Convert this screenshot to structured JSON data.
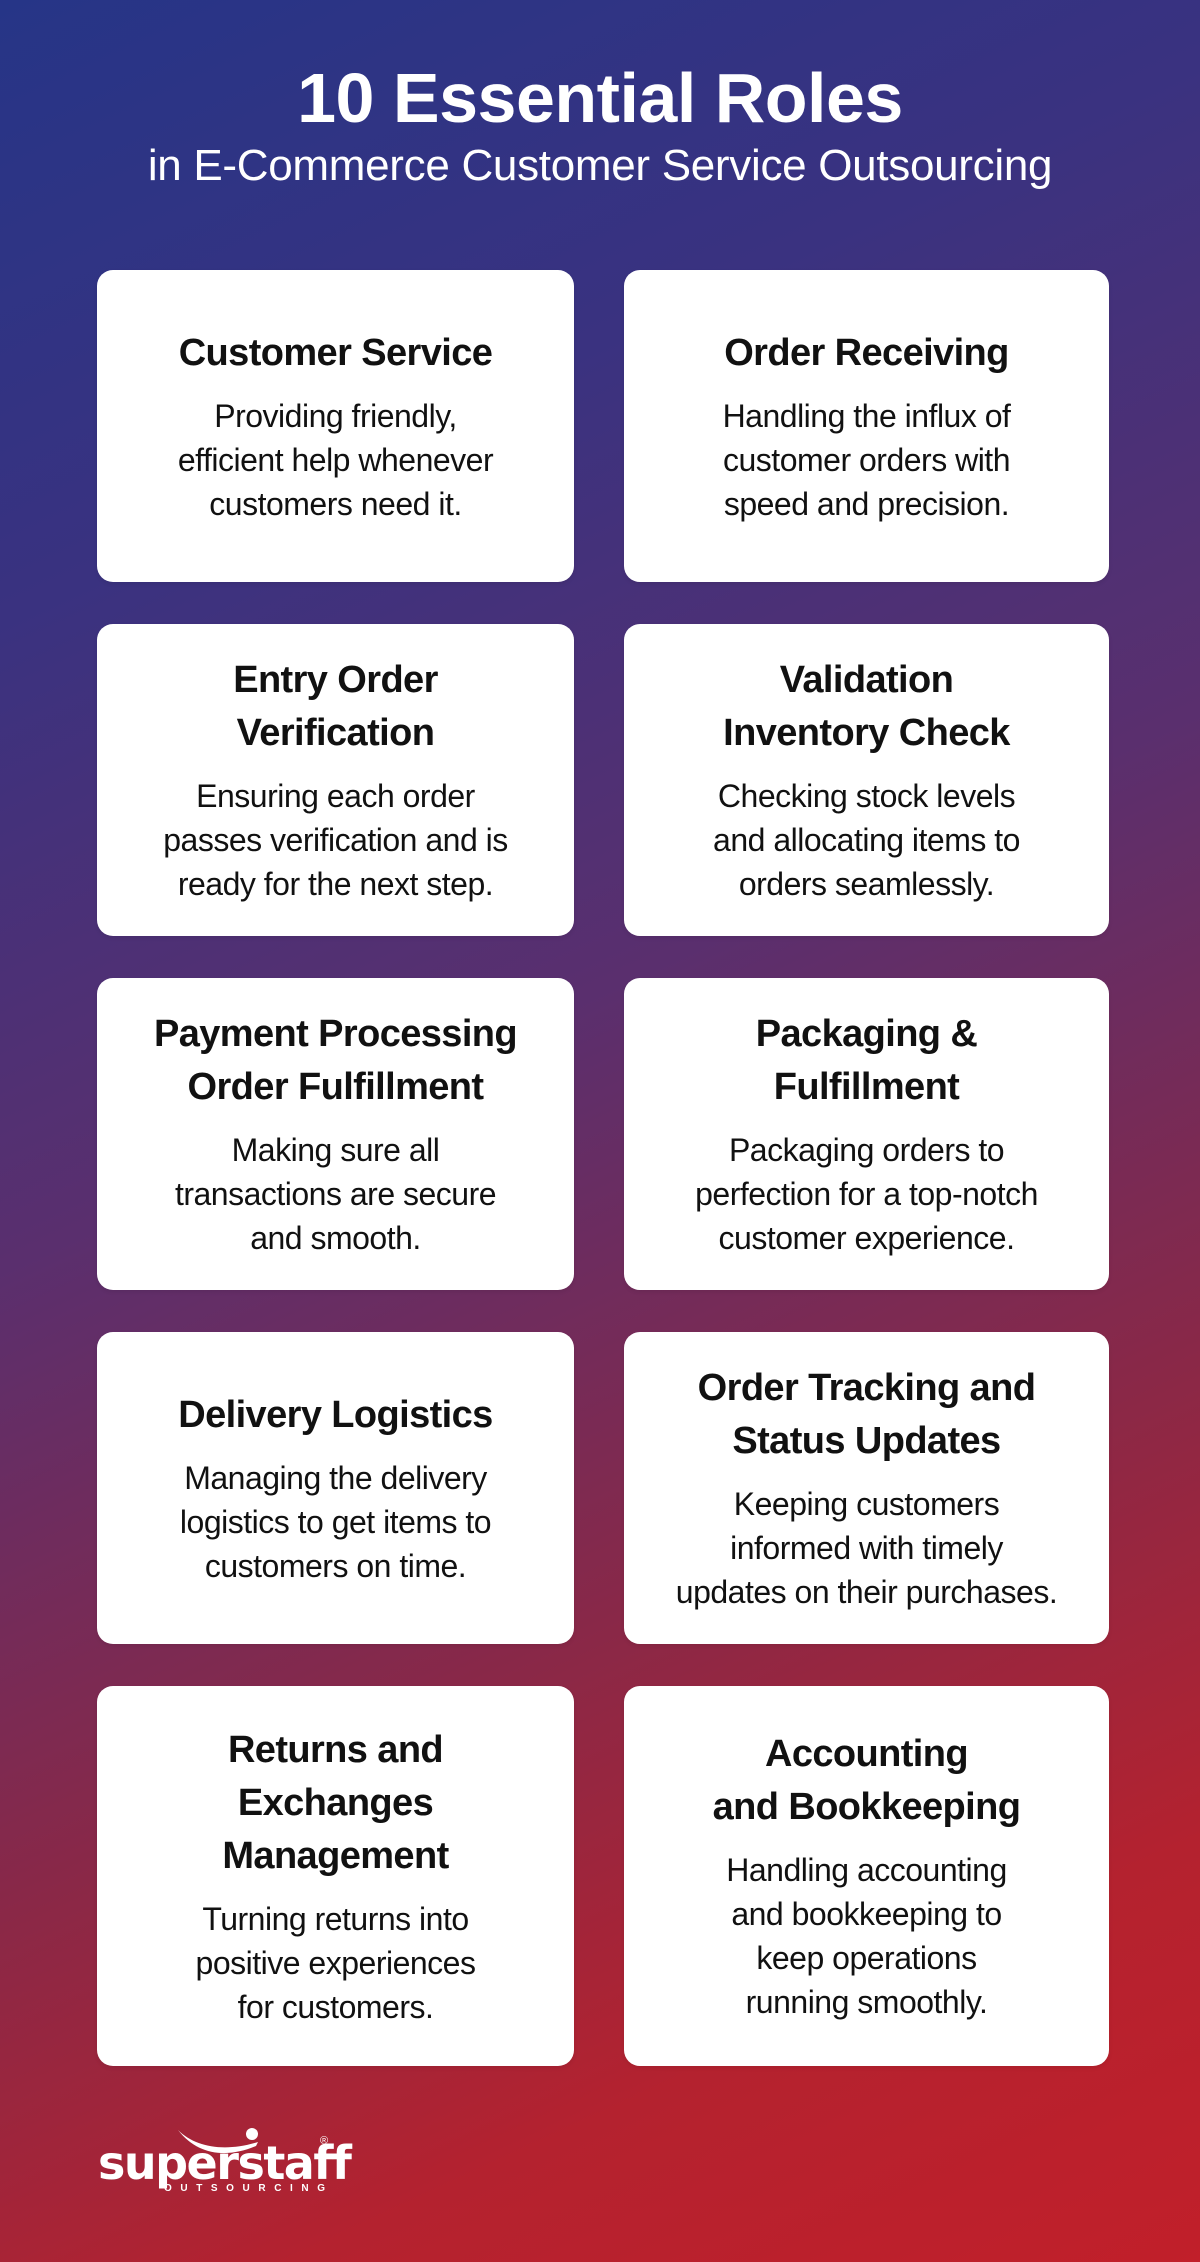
{
  "header": {
    "title": "10 Essential Roles",
    "subtitle": "in E-Commerce Customer Service Outsourcing"
  },
  "colors": {
    "gradient_start": "#263587",
    "gradient_end": "#c11f2a",
    "card_background": "#ffffff",
    "text_light": "#ffffff",
    "text_dark": "#111111"
  },
  "roles": [
    {
      "title_lines": [
        "Customer Service"
      ],
      "body_lines": [
        "Providing friendly,",
        "efficient help whenever",
        "customers need it."
      ]
    },
    {
      "title_lines": [
        "Order Receiving"
      ],
      "body_lines": [
        "Handling the influx of",
        "customer orders with",
        "speed and precision."
      ]
    },
    {
      "title_lines": [
        "Entry Order",
        "Verification"
      ],
      "body_lines": [
        "Ensuring each order",
        "passes verification and is",
        "ready for the next step."
      ]
    },
    {
      "title_lines": [
        "Validation",
        "Inventory Check"
      ],
      "body_lines": [
        "Checking stock levels",
        "and allocating items to",
        "orders seamlessly."
      ]
    },
    {
      "title_lines": [
        "Payment Processing",
        "Order Fulfillment"
      ],
      "body_lines": [
        "Making sure all",
        "transactions are secure",
        "and smooth."
      ]
    },
    {
      "title_lines": [
        "Packaging &",
        "Fulfillment"
      ],
      "body_lines": [
        "Packaging orders to",
        "perfection for a top-notch",
        "customer experience."
      ]
    },
    {
      "title_lines": [
        "Delivery Logistics"
      ],
      "body_lines": [
        "Managing the delivery",
        "logistics to get items to",
        "customers on time."
      ]
    },
    {
      "title_lines": [
        "Order Tracking and",
        "Status Updates"
      ],
      "body_lines": [
        "Keeping customers",
        "informed with timely",
        "updates on their purchases."
      ]
    },
    {
      "title_lines": [
        "Returns and",
        "Exchanges",
        "Management"
      ],
      "body_lines": [
        "Turning returns into",
        "positive experiences",
        "for customers."
      ]
    },
    {
      "title_lines": [
        "Accounting",
        "and Bookkeeping"
      ],
      "body_lines": [
        "Handling accounting",
        "and bookkeeping to",
        "keep operations",
        "running smoothly."
      ]
    }
  ],
  "logo": {
    "wordmark": "superstaff",
    "registered_mark": "®",
    "tagline": "OUTSOURCING",
    "icon": "swoosh-figure-icon"
  }
}
